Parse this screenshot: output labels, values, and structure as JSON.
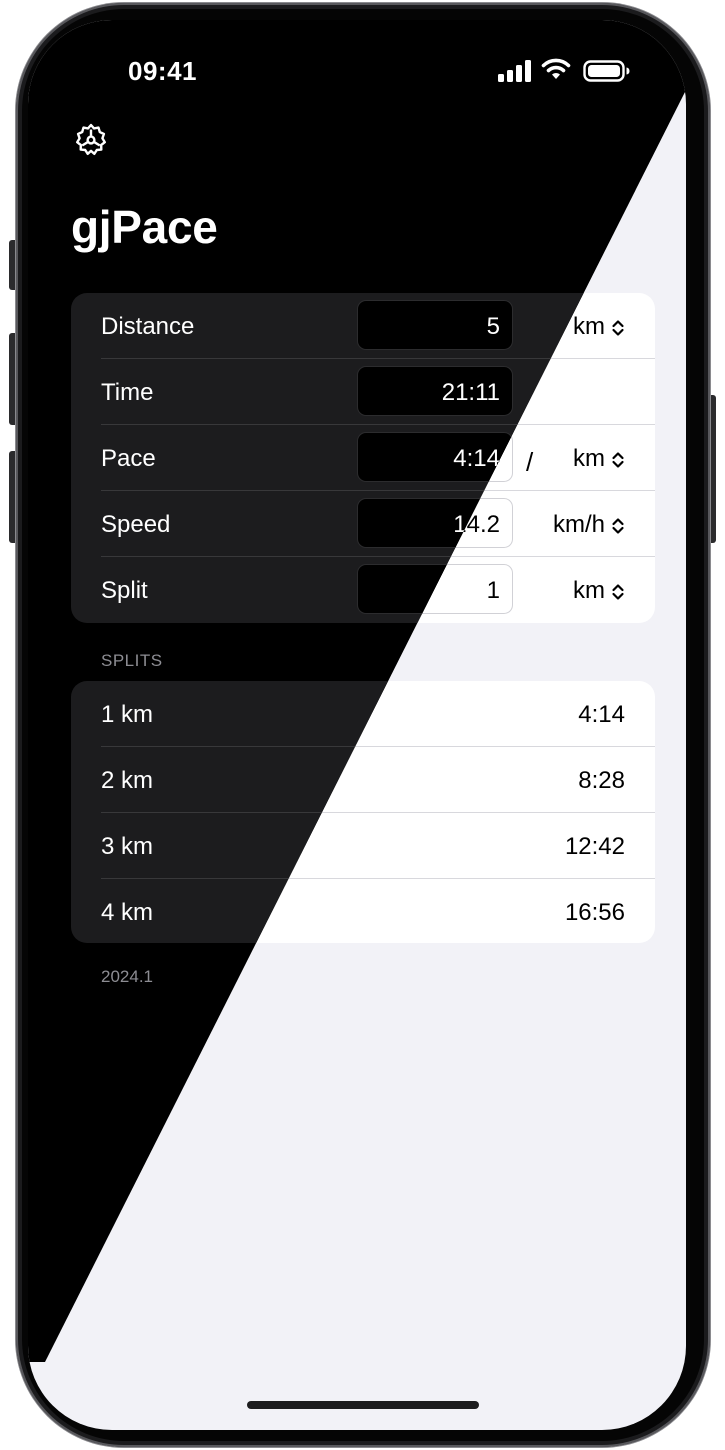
{
  "status_bar": {
    "time": "09:41"
  },
  "app": {
    "title": "gjPace"
  },
  "inputs": [
    {
      "label": "Distance",
      "value": "5",
      "unit": "km",
      "separator": ""
    },
    {
      "label": "Time",
      "value": "21:11",
      "unit": "",
      "separator": ""
    },
    {
      "label": "Pace",
      "value": "4:14",
      "unit": "km",
      "separator": "/"
    },
    {
      "label": "Speed",
      "value": "14.2",
      "unit": "km/h",
      "separator": ""
    },
    {
      "label": "Split",
      "value": "1",
      "unit": "km",
      "separator": ""
    }
  ],
  "splits": {
    "header": "SPLITS",
    "rows": [
      {
        "label": "1 km",
        "time": "4:14"
      },
      {
        "label": "2 km",
        "time": "8:28"
      },
      {
        "label": "3 km",
        "time": "12:42"
      },
      {
        "label": "4 km",
        "time": "16:56"
      }
    ]
  },
  "footer": {
    "version": "2024.1"
  },
  "icons": {
    "settings": "gear-icon",
    "unit_picker": "chevron-up-down-icon",
    "signal": "cellular-signal-icon",
    "wifi": "wifi-icon",
    "battery": "battery-icon"
  },
  "colors": {
    "dark_background": "#000000",
    "dark_card": "#1c1c1e",
    "light_background": "#f2f2f7",
    "light_card": "#ffffff"
  }
}
